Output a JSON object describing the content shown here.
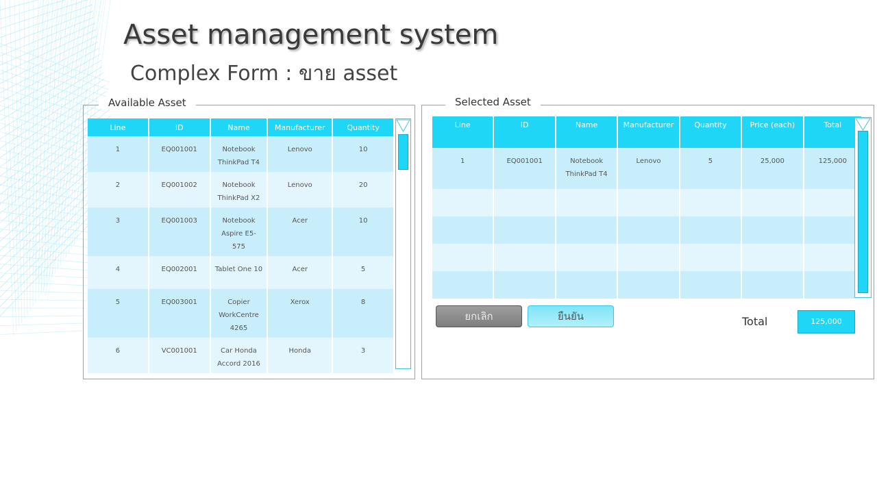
{
  "header": {
    "title": "Asset management system",
    "subtitle": "Complex Form : ขาย asset"
  },
  "available": {
    "legend": "Available Asset",
    "columns": [
      "Line",
      "ID",
      "Name",
      "Manufacturer",
      "Quantity"
    ],
    "rows": [
      {
        "line": "1",
        "id": "EQ001001",
        "name": "Notebook ThinkPad T4",
        "manufacturer": "Lenovo",
        "quantity": "10"
      },
      {
        "line": "2",
        "id": "EQ001002",
        "name": "Notebook ThinkPad X2",
        "manufacturer": "Lenovo",
        "quantity": "20"
      },
      {
        "line": "3",
        "id": "EQ001003",
        "name": "Notebook Aspire E5-575",
        "manufacturer": "Acer",
        "quantity": "10"
      },
      {
        "line": "4",
        "id": "EQ002001",
        "name": "Tablet One 10",
        "manufacturer": "Acer",
        "quantity": "5"
      },
      {
        "line": "5",
        "id": "EQ003001",
        "name": "Copier WorkCentre 4265",
        "manufacturer": "Xerox",
        "quantity": "8"
      },
      {
        "line": "6",
        "id": "VC001001",
        "name": "Car Honda Accord 2016",
        "manufacturer": "Honda",
        "quantity": "3"
      }
    ]
  },
  "selected": {
    "legend": "Selected Asset",
    "columns": [
      "Line",
      "ID",
      "Name",
      "Manufacturer",
      "Quantity",
      "Price (each)",
      "Total"
    ],
    "rows": [
      {
        "line": "1",
        "id": "EQ001001",
        "name": "Notebook ThinkPad T4",
        "manufacturer": "Lenovo",
        "quantity": "5",
        "price": "25,000",
        "total": "125,000"
      },
      {
        "line": "",
        "id": "",
        "name": "",
        "manufacturer": "",
        "quantity": "",
        "price": "",
        "total": ""
      },
      {
        "line": "",
        "id": "",
        "name": "",
        "manufacturer": "",
        "quantity": "",
        "price": "",
        "total": ""
      },
      {
        "line": "",
        "id": "",
        "name": "",
        "manufacturer": "",
        "quantity": "",
        "price": "",
        "total": ""
      },
      {
        "line": "",
        "id": "",
        "name": "",
        "manufacturer": "",
        "quantity": "",
        "price": "",
        "total": ""
      }
    ]
  },
  "actions": {
    "cancel_label": "ยกเลิก",
    "confirm_label": "ยืนยัน"
  },
  "summary": {
    "total_label": "Total",
    "total_value": "125,000"
  },
  "colors": {
    "accent": "#1fd6f7",
    "row_odd": "#c9eefb",
    "row_even": "#e3f6fd",
    "border": "#39c9df"
  }
}
